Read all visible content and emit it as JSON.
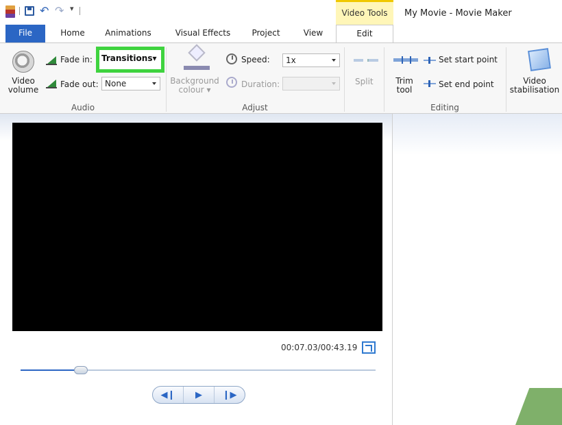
{
  "window": {
    "title": "My Movie - Movie Maker",
    "context_tab_group": "Video Tools"
  },
  "tabs": [
    "File",
    "Home",
    "Animations",
    "Visual Effects",
    "Project",
    "View",
    "Edit"
  ],
  "ribbon": {
    "audio": {
      "group_label": "Audio",
      "video_volume_line1": "Video",
      "video_volume_line2": "volume",
      "fade_in_label": "Fade in:",
      "fade_in_value": "Transitions",
      "fade_out_label": "Fade out:",
      "fade_out_value": "None"
    },
    "adjust": {
      "group_label": "Adjust",
      "bg_colour_line1": "Background",
      "bg_colour_line2": "colour",
      "speed_label": "Speed:",
      "speed_value": "1x",
      "duration_label": "Duration:",
      "duration_value": ""
    },
    "editing": {
      "group_label": "Editing",
      "split_label": "Split",
      "trim_line1": "Trim",
      "trim_line2": "tool",
      "set_start": "Set start point",
      "set_end": "Set end point"
    },
    "stabilisation": {
      "line1": "Video",
      "line2": "stabilisation"
    }
  },
  "player": {
    "timecode": "00:07.03/00:43.19",
    "seek_fraction": 0.17
  },
  "colors": {
    "accent": "#2b66c4",
    "highlight": "#3fd33f",
    "context_tab": "#fff6b8"
  }
}
